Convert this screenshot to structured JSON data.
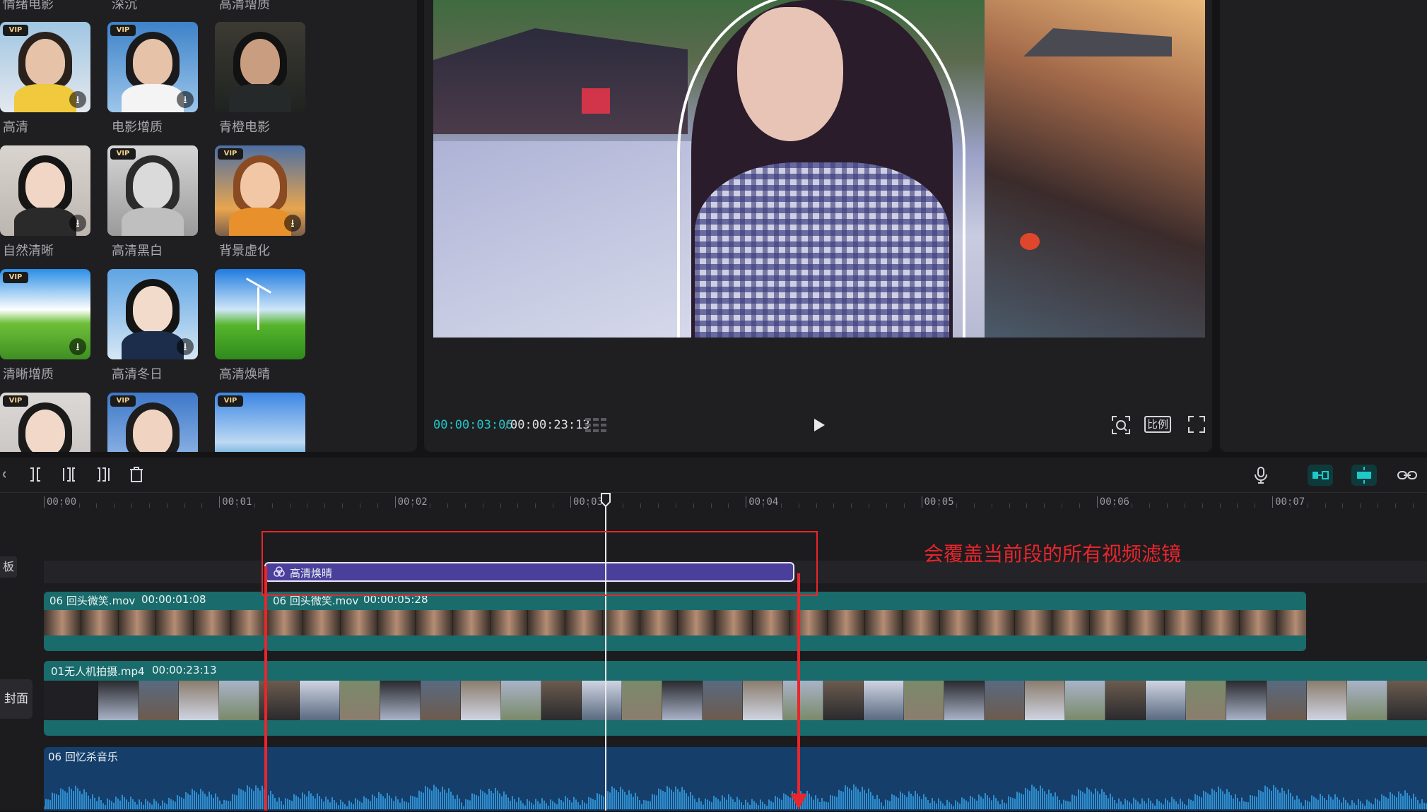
{
  "filters": {
    "top_labels": [
      "情绪电影",
      "深沉",
      "高清增质"
    ],
    "tiles": [
      {
        "label": "高清",
        "vip": true,
        "download": true,
        "style": "portrait-yellow"
      },
      {
        "label": "电影增质",
        "vip": true,
        "download": true,
        "style": "portrait-white"
      },
      {
        "label": "青橙电影",
        "vip": false,
        "download": false,
        "style": "portrait-dark"
      },
      {
        "label": "自然清晰",
        "vip": false,
        "download": true,
        "style": "portrait-light"
      },
      {
        "label": "高清黑白",
        "vip": true,
        "download": false,
        "style": "portrait-bw"
      },
      {
        "label": "背景虚化",
        "vip": true,
        "download": true,
        "style": "portrait-sunset"
      },
      {
        "label": "清晰增质",
        "vip": true,
        "download": true,
        "style": "landscape-flowers"
      },
      {
        "label": "高清冬日",
        "vip": false,
        "download": true,
        "style": "portrait-winter"
      },
      {
        "label": "高清焕晴",
        "vip": false,
        "download": false,
        "style": "landscape-windmill"
      },
      {
        "label": "",
        "vip": true,
        "download": false,
        "style": "portrait-light"
      },
      {
        "label": "",
        "vip": true,
        "download": false,
        "style": "portrait-blue"
      },
      {
        "label": "",
        "vip": true,
        "download": false,
        "style": "landscape-sea"
      }
    ],
    "vip_text": "VIP"
  },
  "player": {
    "current_time": "00:00:03:06",
    "total_time": "00:00:23:13",
    "ratio_label": "比例",
    "icons": [
      "list-icon",
      "play-icon",
      "screenshot-icon",
      "fullscreen-icon"
    ]
  },
  "timeline": {
    "ruler": [
      "00:00",
      "00:01",
      "00:02",
      "00:03",
      "00:04",
      "00:05",
      "00:06",
      "00:07"
    ],
    "sidebar_labels": {
      "filter_track": "板",
      "cover": "封面"
    },
    "filter_clip": {
      "name": "高清焕晴"
    },
    "annotation": "会覆盖当前段的所有视频滤镜",
    "clips": {
      "clip_a": {
        "name": "06 回头微笑.mov",
        "duration": "00:00:01:08"
      },
      "clip_b": {
        "name": "06 回头微笑.mov",
        "duration": "00:00:05:28"
      },
      "main": {
        "name": "01无人机拍摄.mp4",
        "duration": "00:00:23:13"
      },
      "audio": {
        "name": "06 回忆杀音乐"
      }
    }
  },
  "colors": {
    "accent_cyan": "#1fc9c9",
    "annotation_red": "#e8262c",
    "filter_clip": "#4a3f9a",
    "video_track": "#1a6b6b",
    "audio_track": "#153e6b"
  }
}
